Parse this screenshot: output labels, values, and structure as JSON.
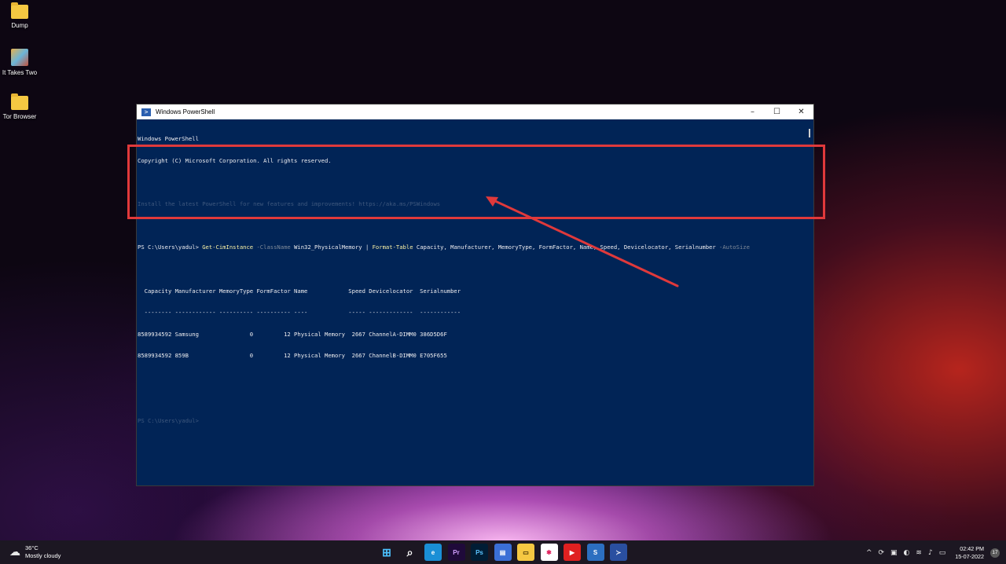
{
  "desktop": {
    "icons": [
      {
        "label": "Dump",
        "icon": "folder-icon"
      },
      {
        "label": "It Takes Two",
        "icon": "game-icon"
      },
      {
        "label": "Tor Browser",
        "icon": "folder-icon"
      }
    ]
  },
  "window": {
    "title": "Windows PowerShell",
    "icon": "powershell-icon",
    "controls": {
      "minimize": "–",
      "maximize": "☐",
      "close": "✕"
    }
  },
  "console": {
    "header1": "Windows PowerShell",
    "header2": "Copyright (C) Microsoft Corporation. All rights reserved.",
    "faded_line": "Install the latest PowerShell for new features and improvements! https://aka.ms/PSWindows",
    "prompt": "PS C:\\Users\\yadul> ",
    "cmd_name": "Get-CimInstance",
    "cmd_param1": " -ClassName",
    "cmd_arg1": " Win32_PhysicalMemory | ",
    "cmd_name2": "Format-Table",
    "cmd_arg2": " Capacity, Manufacturer, MemoryType, FormFactor, Name, Speed, Devicelocator, Serialnumber",
    "cmd_param2": " -AutoSize",
    "table_header": "  Capacity Manufacturer MemoryType FormFactor Name            Speed Devicelocator  Serialnumber",
    "table_separator": "  -------- ------------ ---------- ---------- ----            ----- -------------  ------------",
    "rows": [
      "8589934592 Samsung               0         12 Physical Memory  2667 ChannelA-DIMM0 386D5D6F",
      "8589934592 859B                  0         12 Physical Memory  2667 ChannelB-DIMM0 E705F655"
    ],
    "faded_prompt": "PS C:\\Users\\yadul>"
  },
  "taskbar": {
    "weather_temp": "36°C",
    "weather_desc": "Mostly cloudy",
    "apps": [
      {
        "name": "start-button",
        "glyph": "⊞",
        "color": "#4cc2ff",
        "bg": "transparent"
      },
      {
        "name": "search-button",
        "glyph": "⌕",
        "color": "#ffffff",
        "bg": "transparent"
      },
      {
        "name": "edge-app",
        "glyph": "e",
        "color": "#ffffff",
        "bg": "#1a8fd6"
      },
      {
        "name": "premiere-app",
        "glyph": "Pr",
        "color": "#d3a0ff",
        "bg": "#1f0a3a"
      },
      {
        "name": "photoshop-app",
        "glyph": "Ps",
        "color": "#5cc4ff",
        "bg": "#001d35"
      },
      {
        "name": "tablet-app",
        "glyph": "▤",
        "color": "#ffffff",
        "bg": "#3b6fd6"
      },
      {
        "name": "file-explorer-app",
        "glyph": "▭",
        "color": "#3a2a00",
        "bg": "#f5c842"
      },
      {
        "name": "slack-app",
        "glyph": "✱",
        "color": "#e01e5a",
        "bg": "#ffffff"
      },
      {
        "name": "youtube-app",
        "glyph": "▶",
        "color": "#ffffff",
        "bg": "#e02020"
      },
      {
        "name": "snagit-app",
        "glyph": "S",
        "color": "#ffffff",
        "bg": "#2c6fc0"
      },
      {
        "name": "powershell-app",
        "glyph": "≻",
        "color": "#ffffff",
        "bg": "#2a4fa0"
      }
    ],
    "tray_icons": [
      "^",
      "⟳",
      "▣",
      "◐",
      "≋",
      "♪",
      "▭"
    ],
    "time": "02:42 PM",
    "date": "15-07-2022",
    "notifications": "17"
  }
}
